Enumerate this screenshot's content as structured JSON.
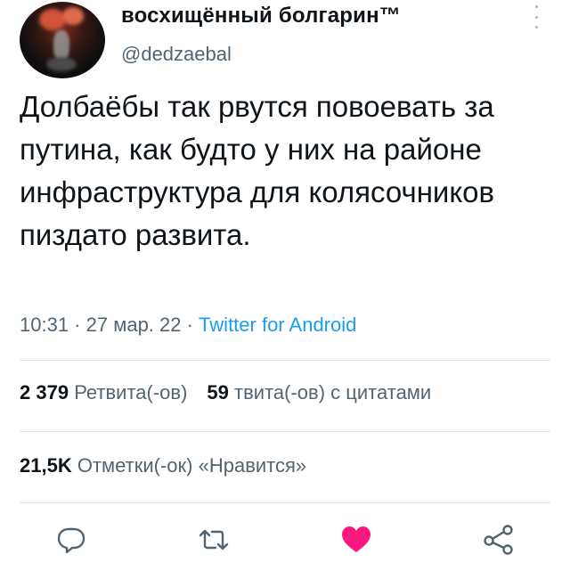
{
  "author": {
    "display_name": "восхищённый болгарин™",
    "handle": "@dedzaebal"
  },
  "tweet": {
    "text": "Долбаёбы так рвутся повоевать за путина, как будто у них на районе инфраструктура для колясочников пиздато развита.",
    "time": "10:31",
    "separator1": " · ",
    "date": "27 мар. 22",
    "separator2": " · ",
    "source": "Twitter for Android"
  },
  "stats": {
    "retweets_count": "2 379",
    "retweets_label": "Ретвита(-ов)",
    "quotes_count": "59",
    "quotes_label": "твита(-ов) с цитатами",
    "likes_count": "21,5K",
    "likes_label": "Отметки(-ок) «Нравится»"
  },
  "actions": {
    "reply_icon": "reply-icon",
    "retweet_icon": "retweet-icon",
    "like_icon": "heart-icon",
    "share_icon": "share-icon"
  },
  "colors": {
    "like_active": "#f91880",
    "link": "#1d9bf0",
    "muted": "#536471"
  }
}
